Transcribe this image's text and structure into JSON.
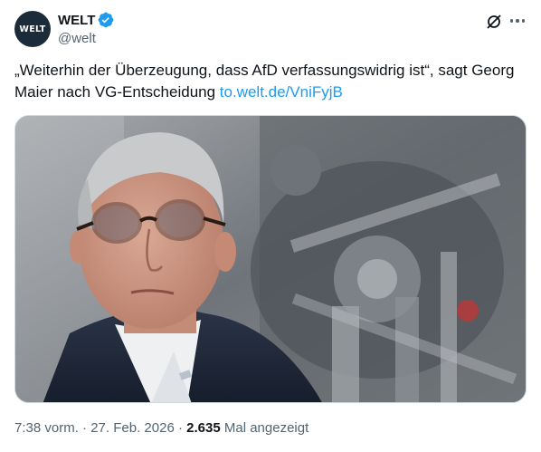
{
  "account": {
    "avatar_text": "WELT",
    "display_name": "WELT",
    "handle": "@welt",
    "verified": true
  },
  "header_icons": [
    "grok-icon",
    "more-icon"
  ],
  "tweet": {
    "text": "„Weiterhin der Überzeugung, dass AfD verfassungswidrig ist“, sagt Georg Maier nach VG-Entscheidung ",
    "link_text": "to.welt.de/VniFyjB"
  },
  "meta": {
    "time": "7:38 vorm.",
    "separator": "·",
    "date": "27. Feb. 2026",
    "views_count": "2.635",
    "views_label": "Mal angezeigt"
  },
  "colors": {
    "link": "#1d9bf0",
    "verified": "#1d9bf0",
    "secondary_text": "#536471",
    "avatar_bg": "#1c2b3a"
  }
}
